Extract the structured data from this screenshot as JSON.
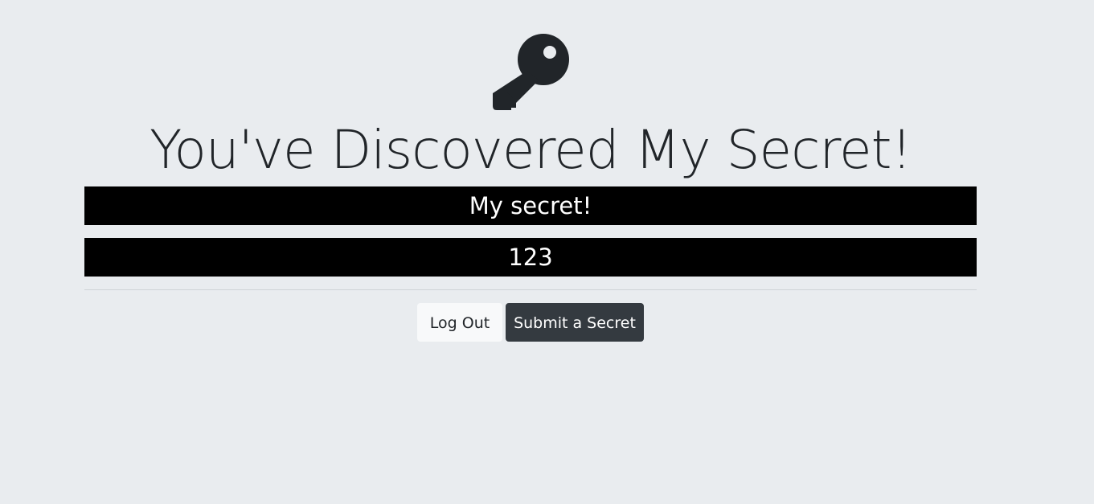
{
  "page": {
    "title": "You've Discovered My Secret!",
    "icon": "key-icon"
  },
  "secrets": [
    {
      "text": "My secret!"
    },
    {
      "text": "123"
    }
  ],
  "actions": {
    "logout_label": "Log Out",
    "submit_label": "Submit a Secret"
  },
  "colors": {
    "background": "#e9ecef",
    "secret_background": "#000000",
    "secret_text": "#ffffff",
    "logout_button": "#f8f9fa",
    "submit_button": "#343a40"
  }
}
